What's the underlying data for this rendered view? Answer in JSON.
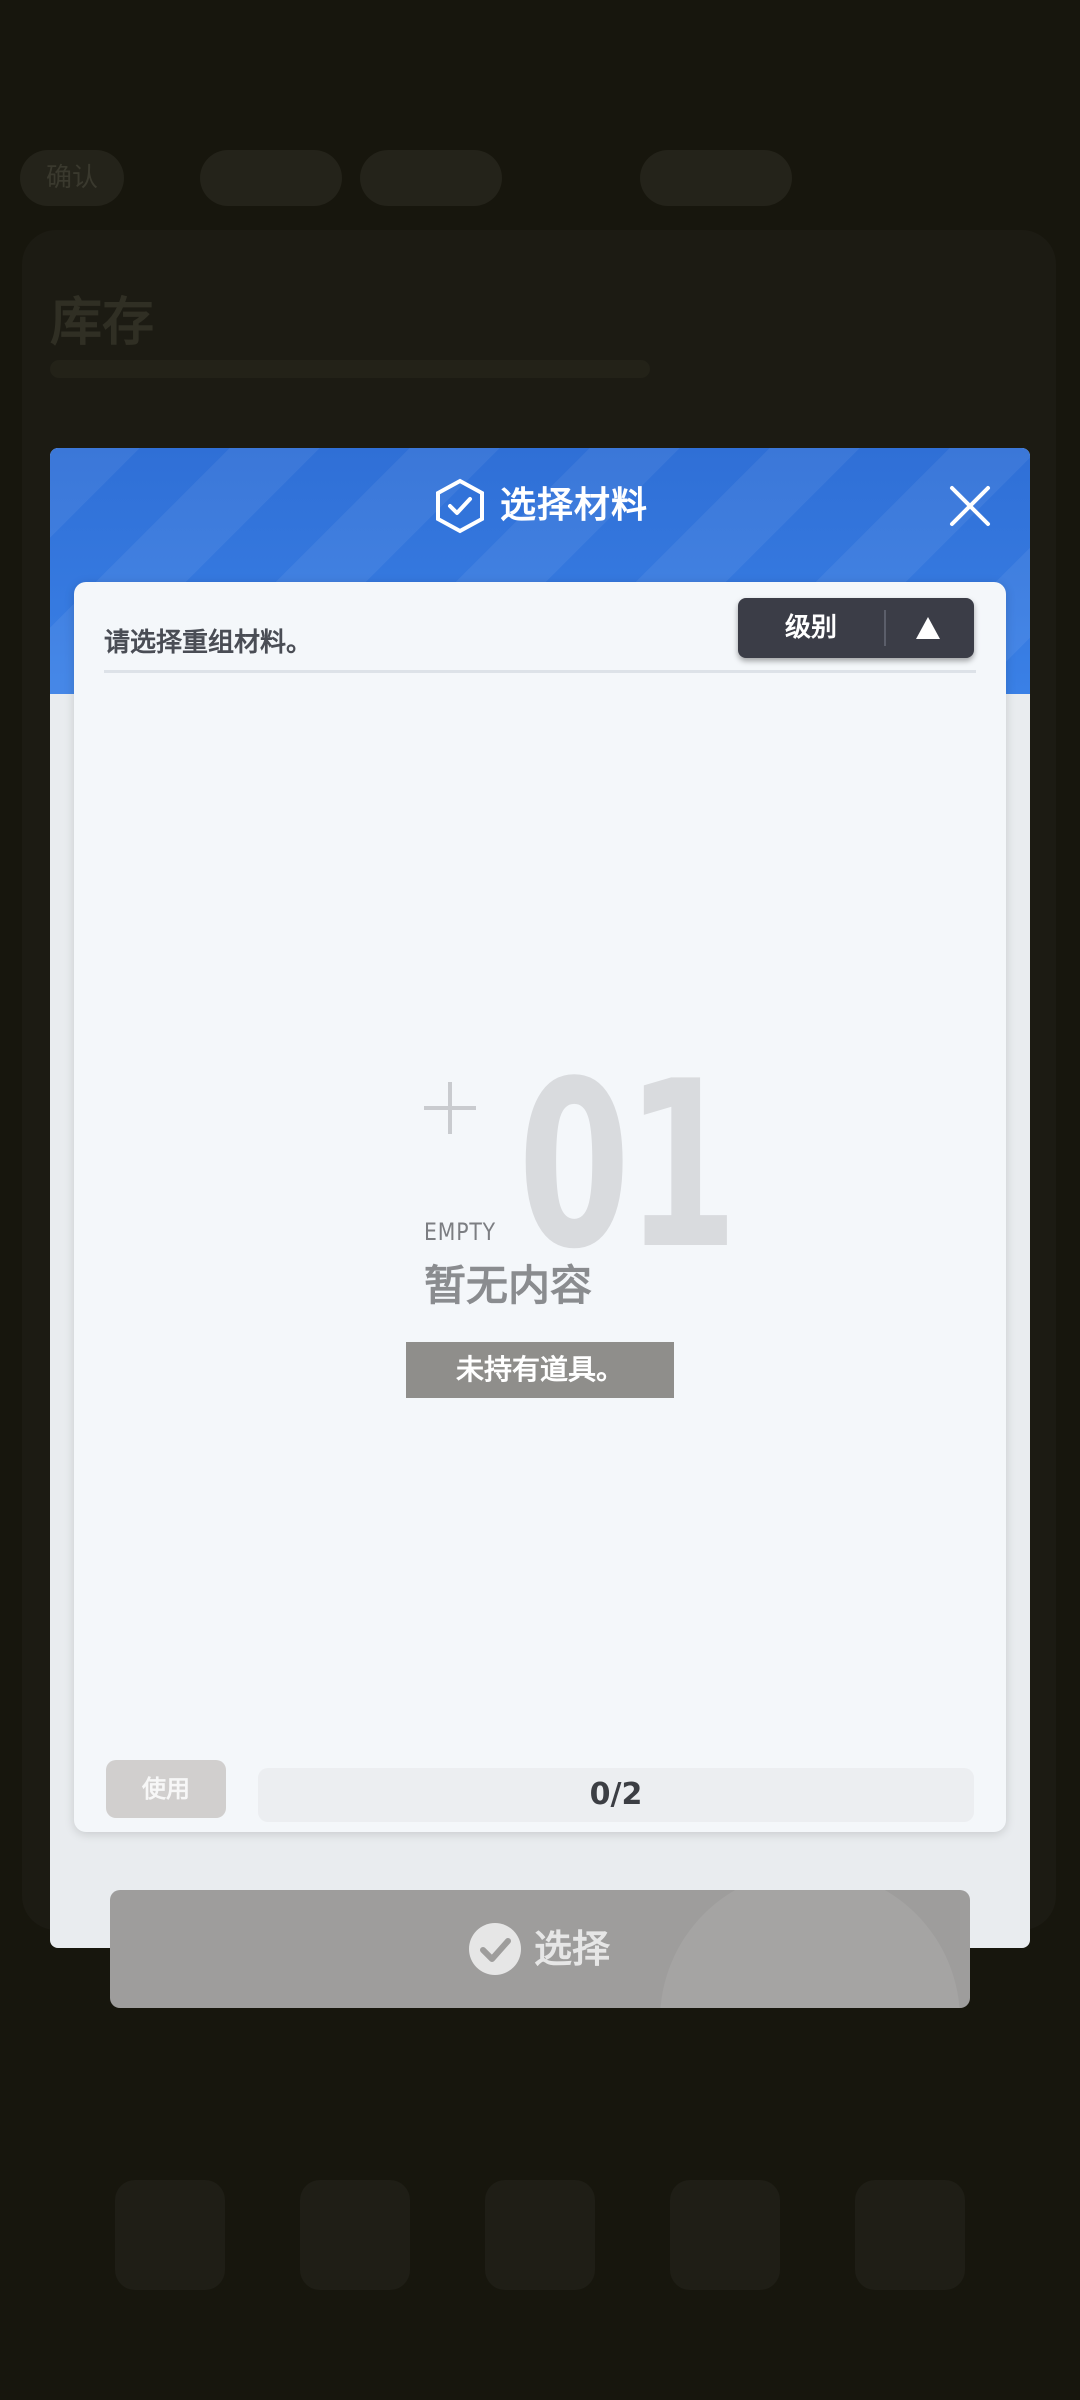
{
  "background": {
    "tabs": [
      "确认",
      "",
      "",
      "",
      ""
    ],
    "panel_title": "库存",
    "nav_labels": [
      "",
      "",
      "",
      "",
      ""
    ]
  },
  "modal": {
    "title": "选择材料",
    "prompt": "请选择重组材料。",
    "sort": {
      "label": "级别",
      "direction_icon": "triangle-up-icon"
    }
  },
  "empty_state": {
    "number": "01",
    "english": "EMPTY",
    "chinese": "暂无内容",
    "message": "未持有道具。"
  },
  "footer": {
    "use_label": "使用",
    "count": "0/2"
  },
  "select_button": {
    "label": "选择"
  },
  "colors": {
    "header_blue": "#3a80e6",
    "sort_button": "#3b3d47",
    "disabled_button": "#9e9d9c"
  }
}
